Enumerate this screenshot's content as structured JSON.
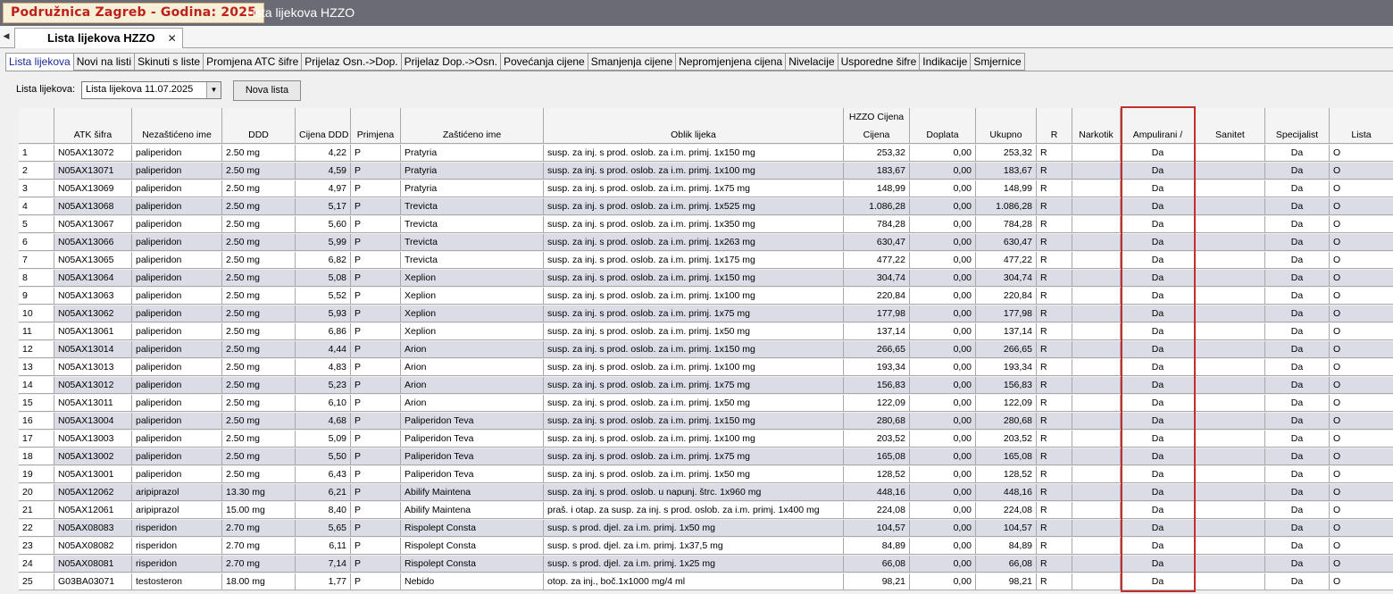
{
  "titlebar": {
    "org": "Podružnica Zagreb - Godina: 2025",
    "window_title": "Lista lijekova HZZO"
  },
  "doc_tab": {
    "label": "Lista lijekova HZZO",
    "close": "✕"
  },
  "subtabs": [
    "Lista lijekova",
    "Novi na listi",
    "Skinuti s liste",
    "Promjena ATC šifre",
    "Prijelaz Osn.->Dop.",
    "Prijelaz Dop.->Osn.",
    "Povećanja cijene",
    "Smanjenja cijene",
    "Nepromjenjena cijena",
    "Nivelacije",
    "Usporedne šifre",
    "Indikacije",
    "Smjernice"
  ],
  "toolbar": {
    "list_label": "Lista lijekova:",
    "list_value": "Lista lijekova 11.07.2025",
    "new_list_button": "Nova lista"
  },
  "table": {
    "group_header": "HZZO Cijena",
    "columns": [
      "",
      "ATK šifra",
      "Nezaštićeno ime",
      "DDD",
      "Cijena DDD",
      "Primjena",
      "Zaštićeno ime",
      "Oblik lijeka",
      "Cijena",
      "Doplata",
      "Ukupno",
      "R",
      "Narkotik",
      "Ampulirani  /",
      "Sanitet",
      "Specijalist",
      "Lista"
    ],
    "rows": [
      [
        "1",
        "N05AX13072",
        "paliperidon",
        "2.50 mg",
        "4,22",
        "P",
        "Pratyria",
        "susp. za inj. s prod. oslob. za i.m. primj. 1x150 mg",
        "253,32",
        "0,00",
        "253,32",
        "R",
        "",
        "Da",
        "",
        "Da",
        "O"
      ],
      [
        "2",
        "N05AX13071",
        "paliperidon",
        "2.50 mg",
        "4,59",
        "P",
        "Pratyria",
        "susp. za inj. s prod. oslob. za i.m. primj. 1x100 mg",
        "183,67",
        "0,00",
        "183,67",
        "R",
        "",
        "Da",
        "",
        "Da",
        "O"
      ],
      [
        "3",
        "N05AX13069",
        "paliperidon",
        "2.50 mg",
        "4,97",
        "P",
        "Pratyria",
        "susp. za inj. s prod. oslob. za i.m. primj. 1x75 mg",
        "148,99",
        "0,00",
        "148,99",
        "R",
        "",
        "Da",
        "",
        "Da",
        "O"
      ],
      [
        "4",
        "N05AX13068",
        "paliperidon",
        "2.50 mg",
        "5,17",
        "P",
        "Trevicta",
        "susp. za inj. s prod. oslob. za i.m. primj. 1x525 mg",
        "1.086,28",
        "0,00",
        "1.086,28",
        "R",
        "",
        "Da",
        "",
        "Da",
        "O"
      ],
      [
        "5",
        "N05AX13067",
        "paliperidon",
        "2.50 mg",
        "5,60",
        "P",
        "Trevicta",
        "susp. za inj. s prod. oslob. za i.m. primj. 1x350 mg",
        "784,28",
        "0,00",
        "784,28",
        "R",
        "",
        "Da",
        "",
        "Da",
        "O"
      ],
      [
        "6",
        "N05AX13066",
        "paliperidon",
        "2.50 mg",
        "5,99",
        "P",
        "Trevicta",
        "susp. za inj. s prod. oslob. za i.m. primj. 1x263 mg",
        "630,47",
        "0,00",
        "630,47",
        "R",
        "",
        "Da",
        "",
        "Da",
        "O"
      ],
      [
        "7",
        "N05AX13065",
        "paliperidon",
        "2.50 mg",
        "6,82",
        "P",
        "Trevicta",
        "susp. za inj. s prod. oslob. za i.m. primj. 1x175 mg",
        "477,22",
        "0,00",
        "477,22",
        "R",
        "",
        "Da",
        "",
        "Da",
        "O"
      ],
      [
        "8",
        "N05AX13064",
        "paliperidon",
        "2.50 mg",
        "5,08",
        "P",
        "Xeplion",
        "susp. za inj. s prod. oslob. za i.m. primj. 1x150 mg",
        "304,74",
        "0,00",
        "304,74",
        "R",
        "",
        "Da",
        "",
        "Da",
        "O"
      ],
      [
        "9",
        "N05AX13063",
        "paliperidon",
        "2.50 mg",
        "5,52",
        "P",
        "Xeplion",
        "susp. za inj. s prod. oslob. za i.m. primj. 1x100 mg",
        "220,84",
        "0,00",
        "220,84",
        "R",
        "",
        "Da",
        "",
        "Da",
        "O"
      ],
      [
        "10",
        "N05AX13062",
        "paliperidon",
        "2.50 mg",
        "5,93",
        "P",
        "Xeplion",
        "susp. za inj. s prod. oslob. za i.m. primj. 1x75 mg",
        "177,98",
        "0,00",
        "177,98",
        "R",
        "",
        "Da",
        "",
        "Da",
        "O"
      ],
      [
        "11",
        "N05AX13061",
        "paliperidon",
        "2.50 mg",
        "6,86",
        "P",
        "Xeplion",
        "susp. za inj. s prod. oslob. za i.m. primj. 1x50 mg",
        "137,14",
        "0,00",
        "137,14",
        "R",
        "",
        "Da",
        "",
        "Da",
        "O"
      ],
      [
        "12",
        "N05AX13014",
        "paliperidon",
        "2.50 mg",
        "4,44",
        "P",
        "Arion",
        "susp. za inj. s prod. oslob. za i.m. primj. 1x150 mg",
        "266,65",
        "0,00",
        "266,65",
        "R",
        "",
        "Da",
        "",
        "Da",
        "O"
      ],
      [
        "13",
        "N05AX13013",
        "paliperidon",
        "2.50 mg",
        "4,83",
        "P",
        "Arion",
        "susp. za inj. s prod. oslob. za i.m. primj. 1x100 mg",
        "193,34",
        "0,00",
        "193,34",
        "R",
        "",
        "Da",
        "",
        "Da",
        "O"
      ],
      [
        "14",
        "N05AX13012",
        "paliperidon",
        "2.50 mg",
        "5,23",
        "P",
        "Arion",
        "susp. za inj. s prod. oslob. za i.m. primj. 1x75 mg",
        "156,83",
        "0,00",
        "156,83",
        "R",
        "",
        "Da",
        "",
        "Da",
        "O"
      ],
      [
        "15",
        "N05AX13011",
        "paliperidon",
        "2.50 mg",
        "6,10",
        "P",
        "Arion",
        "susp. za inj. s prod. oslob. za i.m. primj. 1x50 mg",
        "122,09",
        "0,00",
        "122,09",
        "R",
        "",
        "Da",
        "",
        "Da",
        "O"
      ],
      [
        "16",
        "N05AX13004",
        "paliperidon",
        "2.50 mg",
        "4,68",
        "P",
        "Paliperidon Teva",
        "susp. za inj. s prod. oslob. za i.m. primj. 1x150 mg",
        "280,68",
        "0,00",
        "280,68",
        "R",
        "",
        "Da",
        "",
        "Da",
        "O"
      ],
      [
        "17",
        "N05AX13003",
        "paliperidon",
        "2.50 mg",
        "5,09",
        "P",
        "Paliperidon Teva",
        "susp. za inj. s prod. oslob. za i.m. primj. 1x100 mg",
        "203,52",
        "0,00",
        "203,52",
        "R",
        "",
        "Da",
        "",
        "Da",
        "O"
      ],
      [
        "18",
        "N05AX13002",
        "paliperidon",
        "2.50 mg",
        "5,50",
        "P",
        "Paliperidon Teva",
        "susp. za inj. s prod. oslob. za i.m. primj. 1x75 mg",
        "165,08",
        "0,00",
        "165,08",
        "R",
        "",
        "Da",
        "",
        "Da",
        "O"
      ],
      [
        "19",
        "N05AX13001",
        "paliperidon",
        "2.50 mg",
        "6,43",
        "P",
        "Paliperidon Teva",
        "susp. za inj. s prod. oslob. za i.m. primj. 1x50 mg",
        "128,52",
        "0,00",
        "128,52",
        "R",
        "",
        "Da",
        "",
        "Da",
        "O"
      ],
      [
        "20",
        "N05AX12062",
        "aripiprazol",
        "13.30 mg",
        "6,21",
        "P",
        "Abilify Maintena",
        "susp. za inj. s prod. oslob. u napunj. štrc. 1x960 mg",
        "448,16",
        "0,00",
        "448,16",
        "R",
        "",
        "Da",
        "",
        "Da",
        "O"
      ],
      [
        "21",
        "N05AX12061",
        "aripiprazol",
        "15.00 mg",
        "8,40",
        "P",
        "Abilify Maintena",
        "praš. i otap. za susp. za inj. s prod. oslob. za i.m. primj. 1x400 mg",
        "224,08",
        "0,00",
        "224,08",
        "R",
        "",
        "Da",
        "",
        "Da",
        "O"
      ],
      [
        "22",
        "N05AX08083",
        "risperidon",
        "2.70 mg",
        "5,65",
        "P",
        "Rispolept Consta",
        "susp. s prod. djel. za i.m. primj. 1x50 mg",
        "104,57",
        "0,00",
        "104,57",
        "R",
        "",
        "Da",
        "",
        "Da",
        "O"
      ],
      [
        "23",
        "N05AX08082",
        "risperidon",
        "2.70 mg",
        "6,11",
        "P",
        "Rispolept Consta",
        "susp. s prod. djel. za i.m. primj. 1x37,5 mg",
        "84,89",
        "0,00",
        "84,89",
        "R",
        "",
        "Da",
        "",
        "Da",
        "O"
      ],
      [
        "24",
        "N05AX08081",
        "risperidon",
        "2.70 mg",
        "7,14",
        "P",
        "Rispolept Consta",
        "susp. s prod. djel. za i.m. primj. 1x25 mg",
        "66,08",
        "0,00",
        "66,08",
        "R",
        "",
        "Da",
        "",
        "Da",
        "O"
      ],
      [
        "25",
        "G03BA03071",
        "testosteron",
        "18.00 mg",
        "1,77",
        "P",
        "Nebido",
        "otop. za inj., boč.1x1000 mg/4 ml",
        "98,21",
        "0,00",
        "98,21",
        "R",
        "",
        "Da",
        "",
        "Da",
        "O"
      ]
    ]
  },
  "colors": {
    "highlight_border": "#c22f2f",
    "row_alt": "#dcdce6",
    "titlebar": "#6b6b75",
    "org_text": "#c0201c"
  }
}
